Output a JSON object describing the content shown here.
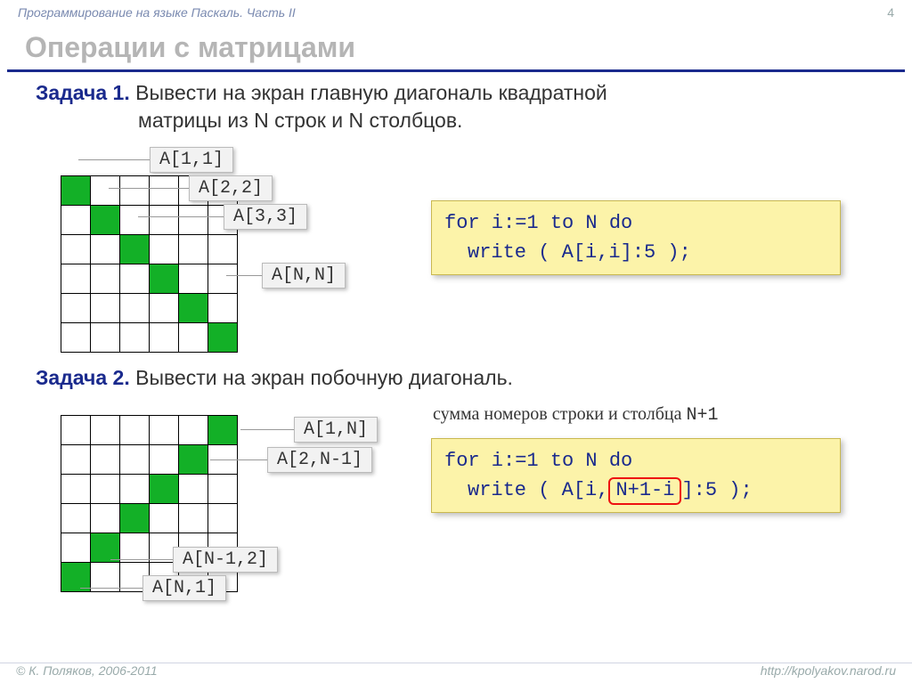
{
  "header": {
    "breadcrumb": "Программирование на языке Паскаль. Часть II",
    "page": "4"
  },
  "title": "Операции с матрицами",
  "task1": {
    "label": "Задача 1.",
    "line1": " Вывести на экран главную диагональ квадратной",
    "line2": "матрицы из N строк и N столбцов.",
    "labels": [
      "A[1,1]",
      "A[2,2]",
      "A[3,3]",
      "A[N,N]"
    ],
    "code": {
      "l1": "for i:=1 to N do",
      "l2": "write ( A[i,i]:5 );"
    }
  },
  "task2": {
    "label": "Задача 2.",
    "text": " Вывести на экран побочную диагональ.",
    "labels": [
      "A[1,N]",
      "A[2,N-1]",
      "A[N-1,2]",
      "A[N,1]"
    ],
    "note_pre": "сумма номеров строки и столбца ",
    "note_mono": "N+1",
    "code": {
      "l1": "for i:=1 to N do",
      "l2a": "write ( A[i,",
      "l2b": "N+1-i",
      "l2c": "]:5 );"
    }
  },
  "footer": {
    "left": "© К. Поляков, 2006-2011",
    "right": "http://kpolyakov.narod.ru"
  }
}
